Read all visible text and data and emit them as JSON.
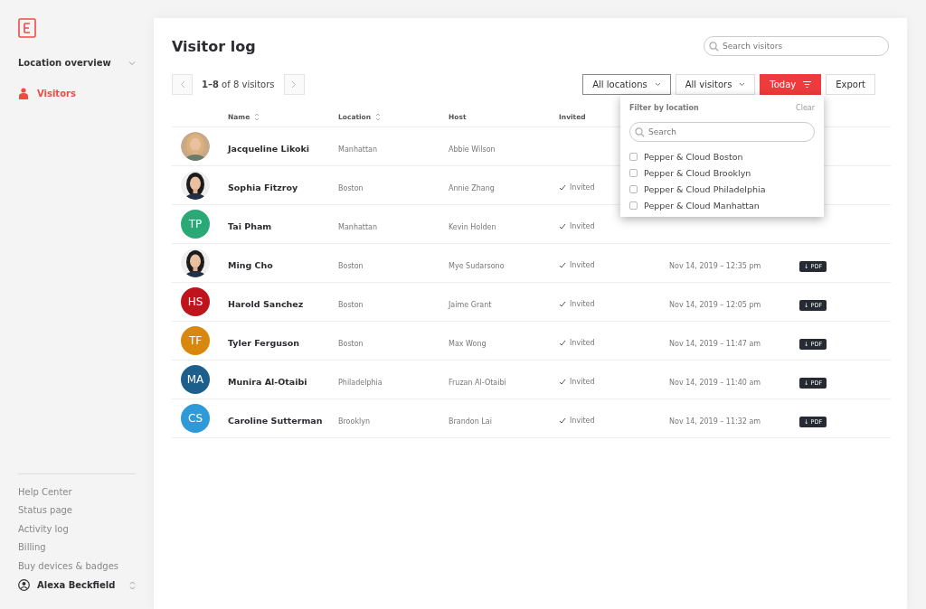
{
  "sidebar": {
    "section": "Location overview",
    "expanded": true,
    "items": [
      {
        "label": "Visitors",
        "selected": true
      }
    ],
    "footer_links": [
      "Help Center",
      "Status page",
      "Activity log",
      "Billing",
      "Buy devices & badges"
    ],
    "user": "Alexa Beckfield"
  },
  "page": {
    "title": "Visitor log",
    "search": {
      "placeholder": "Search visitors"
    },
    "pager": {
      "range": "1–8",
      "rest": "of 8 visitors"
    },
    "filters": [
      {
        "label": "All locations",
        "kind": "dropdown",
        "selected": true
      },
      {
        "label": "All visitors",
        "kind": "dropdown",
        "selected": false
      },
      {
        "label": "Today",
        "kind": "filter",
        "selected": false
      },
      {
        "label": "Export",
        "kind": "plain",
        "selected": false
      }
    ]
  },
  "table": {
    "columns": [
      {
        "label": "Name",
        "sortable": true
      },
      {
        "label": "Location",
        "sortable": true
      },
      {
        "label": "Host",
        "sortable": false
      },
      {
        "label": "Invited",
        "sortable": false
      }
    ],
    "rows": [
      {
        "name": "Jacqueline Likoki",
        "location": "Manhattan",
        "host": "Abbie Wilson"
      },
      {
        "name": "Sophia Fitzroy",
        "location": "Boston",
        "host": "Annie Zhang",
        "invited": "Invited"
      },
      {
        "name": "Tai Pham",
        "location": "Manhattan",
        "host": "Kevin Holden",
        "invited": "Invited",
        "avatar": {
          "kind": "initials",
          "initials": "TP",
          "color": "#2aa876"
        }
      },
      {
        "name": "Ming Cho",
        "location": "Boston",
        "host": "Mye Sudarsono",
        "invited": "Invited",
        "time": "Nov 14, 2019 – 12:35 pm",
        "pdf": "↓ PDF"
      },
      {
        "name": "Harold Sanchez",
        "location": "Boston",
        "host": "Jaime Grant",
        "invited": "Invited",
        "time": "Nov 14, 2019 – 12:05 pm",
        "pdf": "↓ PDF",
        "avatar": {
          "kind": "initials",
          "initials": "HS",
          "color": "#c0141c"
        }
      },
      {
        "name": "Tyler Ferguson",
        "location": "Boston",
        "host": "Max Wong",
        "invited": "Invited",
        "time": "Nov 14, 2019 – 11:47 am",
        "pdf": "↓ PDF",
        "avatar": {
          "kind": "initials",
          "initials": "TF",
          "color": "#d9880f"
        }
      },
      {
        "name": "Munira Al-Otaibi",
        "location": "Philadelphia",
        "host": "Fruzan Al-Otaibi",
        "invited": "Invited",
        "time": "Nov 14, 2019 – 11:40 am",
        "pdf": "↓ PDF",
        "avatar": {
          "kind": "initials",
          "initials": "MA",
          "color": "#1d5f8c"
        }
      },
      {
        "name": "Caroline Sutterman",
        "location": "Brooklyn",
        "host": "Brandon Lai",
        "invited": "Invited",
        "time": "Nov 14, 2019 – 11:32 am",
        "pdf": "↓ PDF",
        "avatar": {
          "kind": "initials",
          "initials": "CS",
          "color": "#2e9ad8"
        }
      }
    ]
  },
  "dropdown": {
    "title": "Filter by location",
    "clear": "Clear",
    "search": {
      "placeholder": "Search"
    },
    "options": [
      {
        "label": "Pepper & Cloud Boston",
        "checked": false
      },
      {
        "label": "Pepper & Cloud Brooklyn",
        "checked": false
      },
      {
        "label": "Pepper & Cloud Philadelphia",
        "checked": false
      },
      {
        "label": "Pepper & Cloud Manhattan",
        "checked": false
      }
    ]
  }
}
